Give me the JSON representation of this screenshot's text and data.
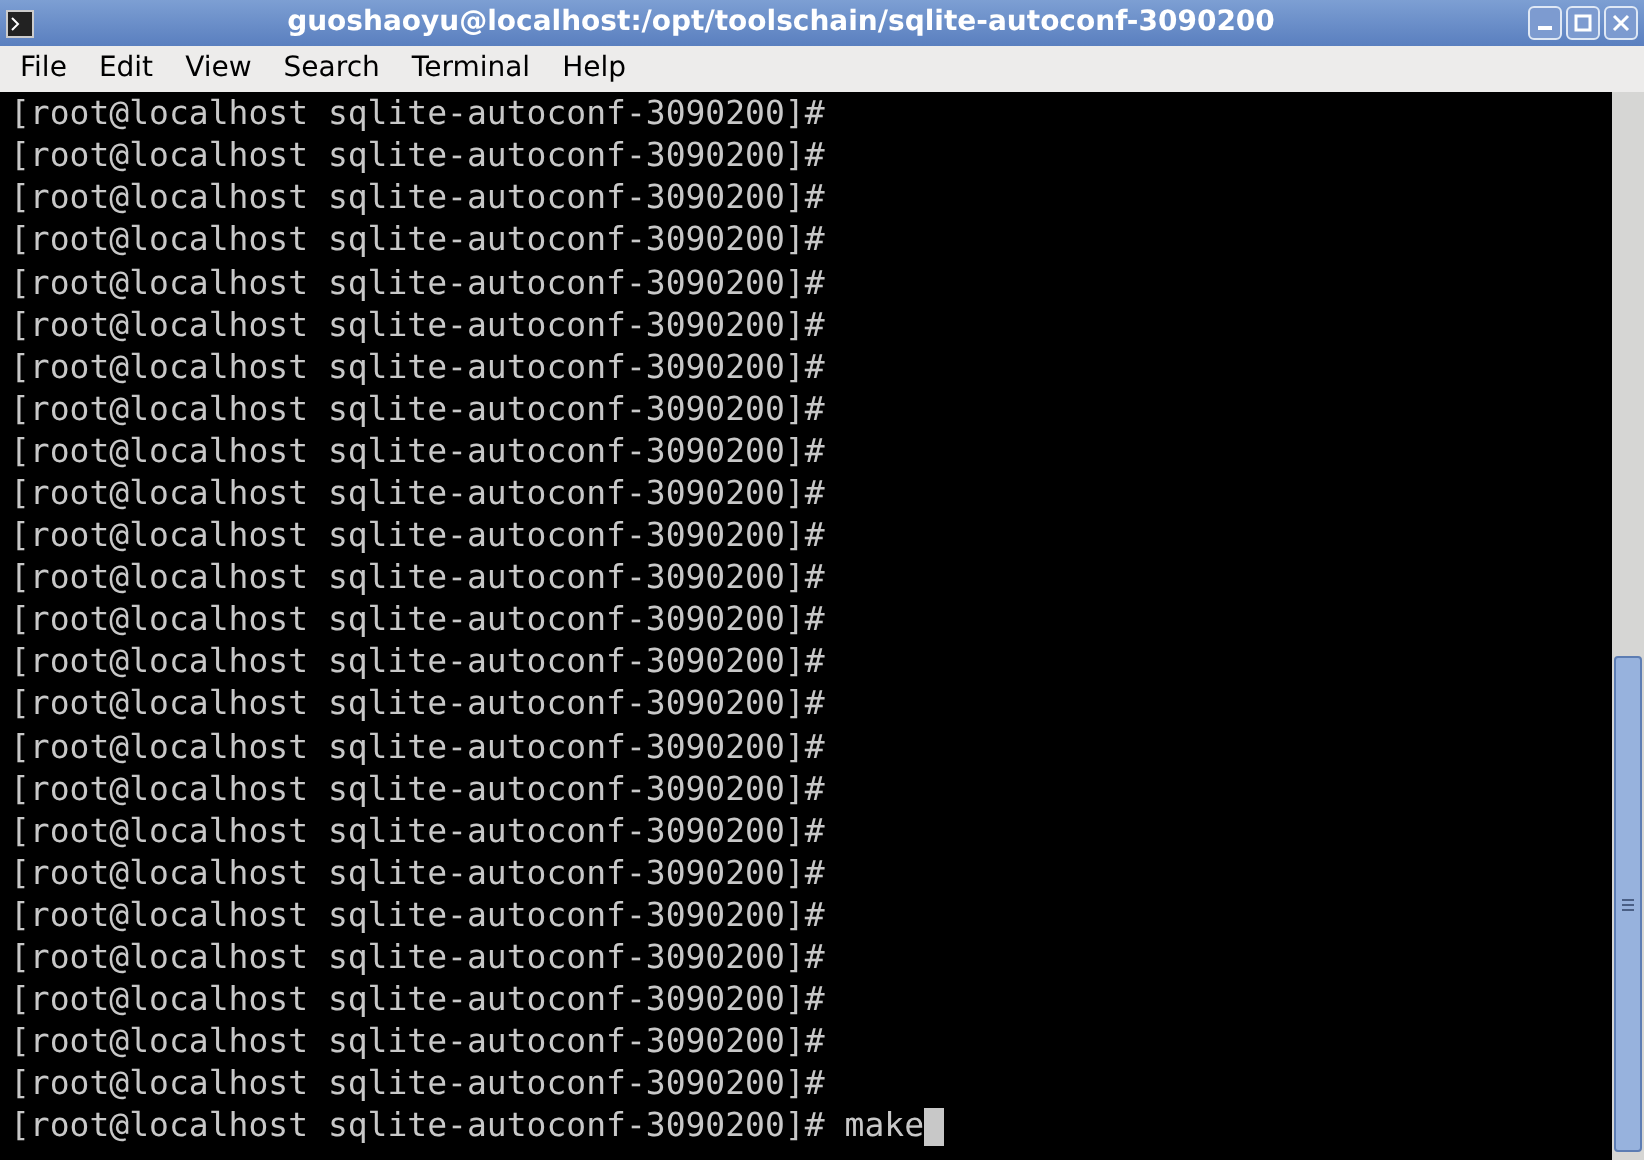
{
  "window": {
    "title": "guoshaoyu@localhost:/opt/toolschain/sqlite-autoconf-3090200"
  },
  "menu": [
    "File",
    "Edit",
    "View",
    "Search",
    "Terminal",
    "Help"
  ],
  "terminal": {
    "cursor_visible": true,
    "lines": [
      {
        "prompt": "[root@localhost sqlite-autoconf-3090200]#"
      },
      {
        "prompt": "[root@localhost sqlite-autoconf-3090200]#"
      },
      {
        "prompt": "[root@localhost sqlite-autoconf-3090200]#"
      },
      {
        "prompt": "[root@localhost sqlite-autoconf-3090200]#"
      },
      {
        "prompt": "[root@localhost sqlite-autoconf-3090200]#"
      },
      {
        "prompt": "[root@localhost sqlite-autoconf-3090200]#"
      },
      {
        "prompt": "[root@localhost sqlite-autoconf-3090200]#"
      },
      {
        "prompt": "[root@localhost sqlite-autoconf-3090200]#"
      },
      {
        "prompt": "[root@localhost sqlite-autoconf-3090200]#"
      },
      {
        "prompt": "[root@localhost sqlite-autoconf-3090200]#"
      },
      {
        "prompt": "[root@localhost sqlite-autoconf-3090200]#"
      },
      {
        "prompt": "[root@localhost sqlite-autoconf-3090200]#"
      },
      {
        "prompt": "[root@localhost sqlite-autoconf-3090200]#"
      },
      {
        "prompt": "[root@localhost sqlite-autoconf-3090200]#"
      },
      {
        "prompt": "[root@localhost sqlite-autoconf-3090200]#"
      },
      {
        "prompt": "[root@localhost sqlite-autoconf-3090200]#"
      },
      {
        "prompt": "[root@localhost sqlite-autoconf-3090200]#"
      },
      {
        "prompt": "[root@localhost sqlite-autoconf-3090200]#"
      },
      {
        "prompt": "[root@localhost sqlite-autoconf-3090200]#"
      },
      {
        "prompt": "[root@localhost sqlite-autoconf-3090200]#"
      },
      {
        "prompt": "[root@localhost sqlite-autoconf-3090200]#"
      },
      {
        "prompt": "[root@localhost sqlite-autoconf-3090200]#"
      },
      {
        "prompt": "[root@localhost sqlite-autoconf-3090200]#"
      },
      {
        "prompt": "[root@localhost sqlite-autoconf-3090200]#"
      },
      {
        "prompt": "[root@localhost sqlite-autoconf-3090200]#",
        "command": "make"
      }
    ]
  }
}
